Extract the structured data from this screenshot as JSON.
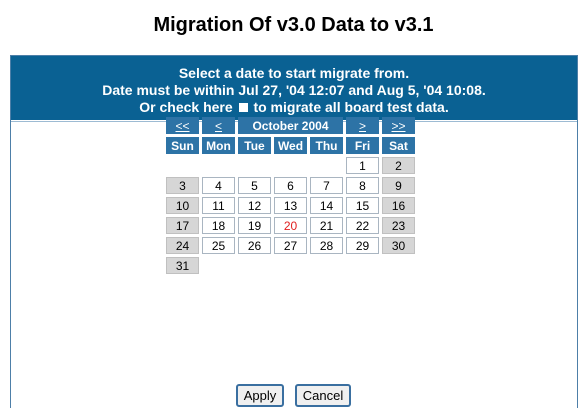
{
  "page": {
    "title": "Migration Of v3.0 Data to v3.1"
  },
  "header": {
    "line1": "Select a date to start migrate from.",
    "line2": "Date must be within Jul 27, '04 12:07 and Aug 5, '04 10:08.",
    "line3_before": "Or check here",
    "line3_after": "to migrate all board test data."
  },
  "calendar": {
    "nav": {
      "prev_year": "<<",
      "prev_month": "<",
      "next_month": ">",
      "next_year": ">>"
    },
    "month_label": "October 2004",
    "weekdays": [
      "Sun",
      "Mon",
      "Tue",
      "Wed",
      "Thu",
      "Fri",
      "Sat"
    ],
    "weeks": [
      [
        "",
        "",
        "",
        "",
        "",
        "1",
        "2"
      ],
      [
        "3",
        "4",
        "5",
        "6",
        "7",
        "8",
        "9"
      ],
      [
        "10",
        "11",
        "12",
        "13",
        "14",
        "15",
        "16"
      ],
      [
        "17",
        "18",
        "19",
        "20",
        "21",
        "22",
        "23"
      ],
      [
        "24",
        "25",
        "26",
        "27",
        "28",
        "29",
        "30"
      ],
      [
        "31",
        "",
        "",
        "",
        "",
        "",
        ""
      ]
    ],
    "highlighted_day": "20",
    "colors": {
      "header_bg": "#0a6193",
      "cal_header_bg": "#2d73a6",
      "weekend_bg": "#d6d6d6",
      "highlight_text": "#e02020"
    }
  },
  "buttons": {
    "apply": "Apply",
    "cancel": "Cancel"
  }
}
